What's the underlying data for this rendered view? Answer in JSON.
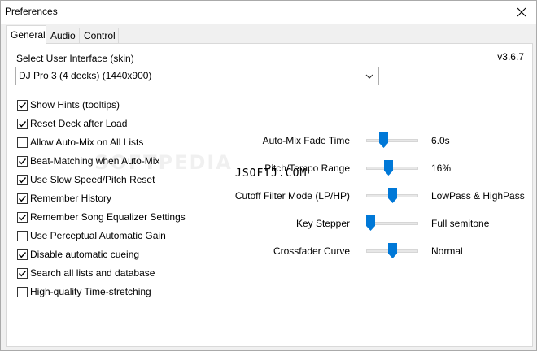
{
  "window": {
    "title": "Preferences"
  },
  "tabs": [
    {
      "label": "General",
      "active": true
    },
    {
      "label": "Audio",
      "active": false
    },
    {
      "label": "Control",
      "active": false
    }
  ],
  "general": {
    "skin_label": "Select User Interface (skin)",
    "version": "v3.6.7",
    "skin_value": "DJ Pro 3 (4 decks) (1440x900)",
    "checkboxes": [
      {
        "label": "Show Hints (tooltips)",
        "checked": true
      },
      {
        "label": "Reset Deck after Load",
        "checked": true
      },
      {
        "label": "Allow Auto-Mix on All Lists",
        "checked": false
      },
      {
        "label": "Beat-Matching when Auto-Mix",
        "checked": true
      },
      {
        "label": "Use Slow Speed/Pitch Reset",
        "checked": true
      },
      {
        "label": "Remember History",
        "checked": true
      },
      {
        "label": "Remember Song Equalizer Settings",
        "checked": true
      },
      {
        "label": "Use Perceptual Automatic Gain",
        "checked": false
      },
      {
        "label": "Disable automatic cueing",
        "checked": true
      },
      {
        "label": "Search all lists and database",
        "checked": true
      },
      {
        "label": "High-quality Time-stretching",
        "checked": false
      }
    ],
    "sliders": [
      {
        "label": "Auto-Mix Fade Time",
        "value": "6.0s",
        "position": 0.3
      },
      {
        "label": "Pitch/Tempo Range",
        "value": "16%",
        "position": 0.42
      },
      {
        "label": "Cutoff Filter Mode (LP/HP)",
        "value": "LowPass & HighPass",
        "position": 0.5
      },
      {
        "label": "Key Stepper",
        "value": "Full semitone",
        "position": 0.0
      },
      {
        "label": "Crossfader Curve",
        "value": "Normal",
        "position": 0.5
      }
    ]
  },
  "watermark": {
    "text": "JSOFTJ.COM",
    "faint_text": "SOFTPEDIA"
  },
  "colors": {
    "accent": "#0078d7",
    "checkmark": "#000000"
  }
}
